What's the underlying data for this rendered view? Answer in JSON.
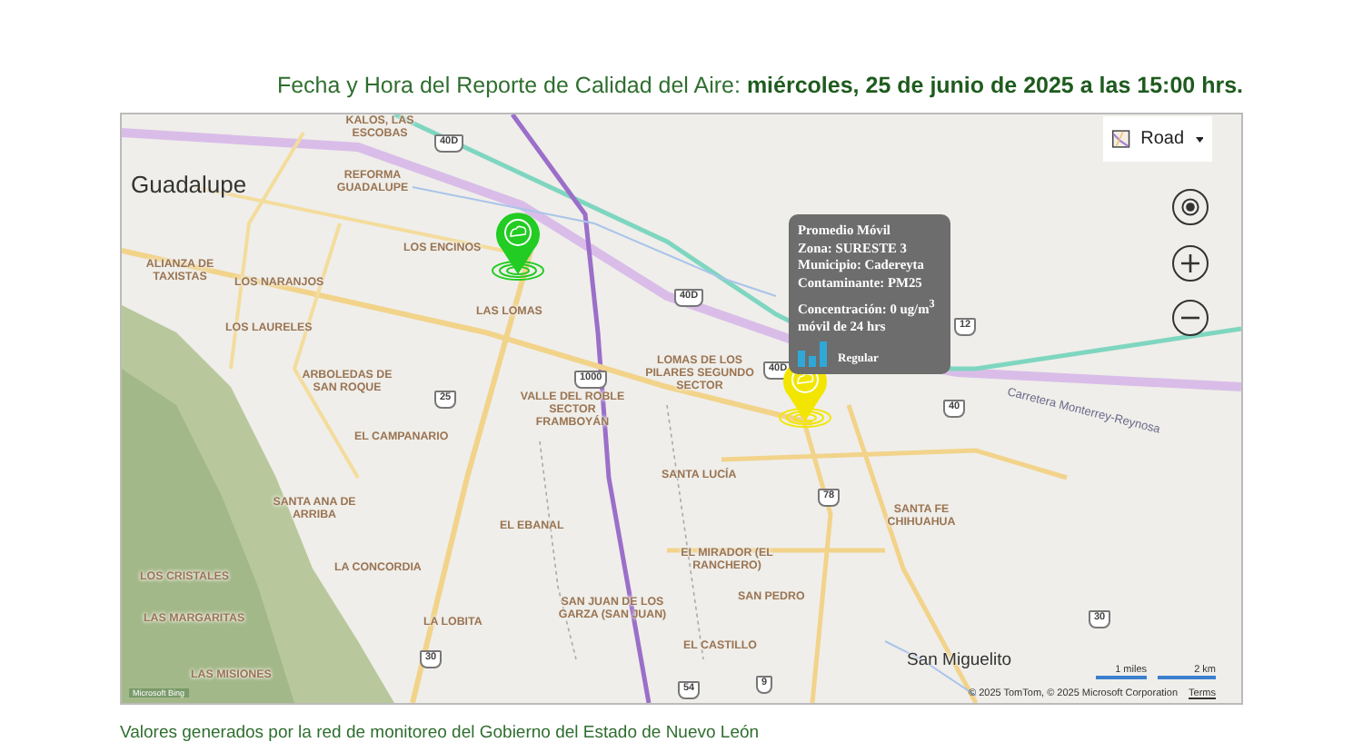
{
  "header": {
    "label": "Fecha y Hora del Reporte de Calidad del Aire:",
    "value": "miércoles, 25 de junio de 2025 a las 15:00 hrs."
  },
  "map": {
    "style_selector": {
      "label": "Road"
    },
    "places": [
      {
        "name": "KALOS, LAS ESCOBAS",
        "kind": "neighborhood"
      },
      {
        "name": "Guadalupe",
        "kind": "city"
      },
      {
        "name": "REFORMA GUADALUPE",
        "kind": "neighborhood"
      },
      {
        "name": "LOS ENCINOS",
        "kind": "neighborhood"
      },
      {
        "name": "ALIANZA DE TAXISTAS",
        "kind": "neighborhood"
      },
      {
        "name": "LOS NARANJOS",
        "kind": "neighborhood"
      },
      {
        "name": "LOS LAURELES",
        "kind": "neighborhood"
      },
      {
        "name": "LAS LOMAS",
        "kind": "neighborhood"
      },
      {
        "name": "ARBOLEDAS DE SAN ROQUE",
        "kind": "neighborhood"
      },
      {
        "name": "VALLE DEL ROBLE SECTOR FRAMBOYÁN",
        "kind": "neighborhood"
      },
      {
        "name": "EL CAMPANARIO",
        "kind": "neighborhood"
      },
      {
        "name": "LOMAS DE LOS PILARES SEGUNDO SECTOR",
        "kind": "neighborhood"
      },
      {
        "name": "SANTA LUCÍA",
        "kind": "neighborhood"
      },
      {
        "name": "SANTA ANA DE ARRIBA",
        "kind": "neighborhood"
      },
      {
        "name": "EL EBANAL",
        "kind": "neighborhood"
      },
      {
        "name": "SANTA FE CHIHUAHUA",
        "kind": "neighborhood"
      },
      {
        "name": "EL MIRADOR (EL RANCHERO)",
        "kind": "neighborhood"
      },
      {
        "name": "LOS CRISTALES",
        "kind": "neighborhood"
      },
      {
        "name": "LA CONCORDIA",
        "kind": "neighborhood"
      },
      {
        "name": "SAN PEDRO",
        "kind": "neighborhood"
      },
      {
        "name": "LAS MARGARITAS",
        "kind": "neighborhood"
      },
      {
        "name": "SAN JUAN DE LOS GARZA (SAN JUAN)",
        "kind": "neighborhood"
      },
      {
        "name": "LA LOBITA",
        "kind": "neighborhood"
      },
      {
        "name": "EL CASTILLO",
        "kind": "neighborhood"
      },
      {
        "name": "LAS MISIONES",
        "kind": "neighborhood"
      },
      {
        "name": "San Miguelito",
        "kind": "town"
      },
      {
        "name": "Carretera Monterrey-Reynosa",
        "kind": "road"
      }
    ],
    "shields": [
      "40D",
      "40D",
      "40D",
      "1000",
      "25",
      "12",
      "40",
      "78",
      "30",
      "54",
      "9",
      "30"
    ],
    "stations": [
      {
        "color": "#22cc22"
      },
      {
        "color": "#f2e600"
      }
    ],
    "popup": {
      "title": "Promedio Móvil",
      "lines": [
        "Zona: SURESTE 3",
        "Municipio: Cadereyta",
        "Contaminante: PM25"
      ],
      "concentration": "Concentración: 0 ug/m$^{3}$ móvil de 24 hrs",
      "category": "Regular"
    },
    "scale": {
      "miles": "1 miles",
      "km": "2 km"
    },
    "attribution": "© 2025 TomTom, © 2025 Microsoft Corporation",
    "terms_link": "Terms",
    "logo": "Microsoft Bing"
  },
  "footer": "Valores generados por la red de monitoreo del Gobierno del Estado de Nuevo León"
}
